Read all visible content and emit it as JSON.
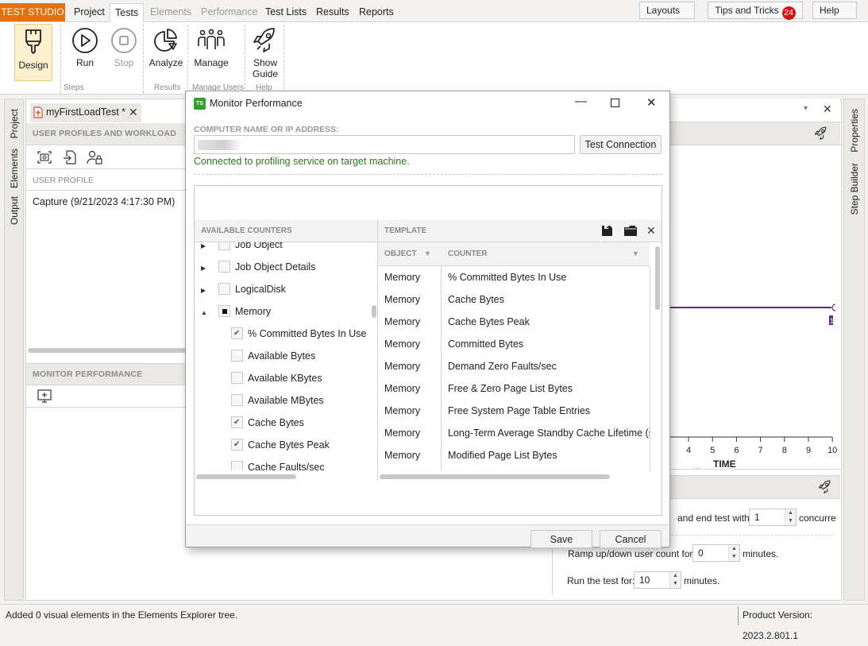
{
  "menubar": {
    "brand": "TEST STUDIO",
    "tabs": [
      {
        "label": "Project",
        "state": "normal"
      },
      {
        "label": "Tests",
        "state": "active"
      },
      {
        "label": "Elements",
        "state": "disabled"
      },
      {
        "label": "Performance",
        "state": "disabled"
      },
      {
        "label": "Test Lists",
        "state": "normal"
      },
      {
        "label": "Results",
        "state": "normal"
      },
      {
        "label": "Reports",
        "state": "normal"
      }
    ],
    "layouts_label": "Layouts",
    "tips_label": "Tips and Tricks",
    "tips_count": "24",
    "help_label": "Help"
  },
  "ribbon": {
    "buttons": {
      "design": "Design",
      "run": "Run",
      "stop": "Stop",
      "analyze": "Analyze",
      "manage": "Manage",
      "show_guide_1": "Show",
      "show_guide_2": "Guide"
    },
    "groups": {
      "steps": "Steps",
      "results": "Results",
      "manage_users": "Manage Users",
      "help": "Help"
    }
  },
  "left_strip": {
    "tabs": [
      "Project",
      "Elements",
      "Output"
    ]
  },
  "right_strip": {
    "tabs": [
      "Properties",
      "Step Builder"
    ]
  },
  "document": {
    "tab_label": "myFirstLoadTest *",
    "user_profiles_header": "USER PROFILES AND WORKLOAD",
    "user_profile_col": "USER PROFILE",
    "profiles": [
      "Capture (9/21/2023 4:17:30 PM)"
    ],
    "monitor_header": "MONITOR PERFORMANCE"
  },
  "chart_panel": {
    "x_ticks": [
      "4",
      "5",
      "6",
      "7",
      "8",
      "9",
      "10"
    ],
    "x_label": "TIME",
    "end_marker_label": "1",
    "line_color": "#5b2d8e"
  },
  "workload": {
    "end_test_label": "and end test with",
    "end_users_value": "1",
    "concurrent_label": "concurre",
    "ramp_label": "Ramp up/down user count for:",
    "ramp_value": "0",
    "ramp_unit": "minutes.",
    "run_label": "Run the test for:",
    "run_value": "10",
    "run_unit": "minutes."
  },
  "dialog": {
    "title": "Monitor Performance",
    "app_icon": "TS",
    "computer_label": "COMPUTER NAME OR IP ADDRESS:",
    "computer_value": "",
    "test_connection": "Test Connection",
    "status": "Connected to profiling service on target machine.",
    "available_header": "AVAILABLE COUNTERS",
    "tree": [
      {
        "label": "Job Object",
        "level": 0,
        "expander": "collapsed",
        "check": "none"
      },
      {
        "label": "Job Object Details",
        "level": 0,
        "expander": "collapsed",
        "check": "none"
      },
      {
        "label": "LogicalDisk",
        "level": 0,
        "expander": "collapsed",
        "check": "none"
      },
      {
        "label": "Memory",
        "level": 0,
        "expander": "expanded",
        "check": "partial"
      },
      {
        "label": "% Committed Bytes In Use",
        "level": 1,
        "check": "checked"
      },
      {
        "label": "Available Bytes",
        "level": 1,
        "check": "none"
      },
      {
        "label": "Available KBytes",
        "level": 1,
        "check": "none"
      },
      {
        "label": "Available MBytes",
        "level": 1,
        "check": "none"
      },
      {
        "label": "Cache Bytes",
        "level": 1,
        "check": "checked"
      },
      {
        "label": "Cache Bytes Peak",
        "level": 1,
        "check": "checked"
      },
      {
        "label": "Cache Faults/sec",
        "level": 1,
        "check": "none"
      }
    ],
    "template_header": "TEMPLATE",
    "columns": {
      "object": "OBJECT",
      "counter": "COUNTER"
    },
    "rows": [
      {
        "object": "Memory",
        "counter": "% Committed Bytes In Use"
      },
      {
        "object": "Memory",
        "counter": "Cache Bytes"
      },
      {
        "object": "Memory",
        "counter": "Cache Bytes Peak"
      },
      {
        "object": "Memory",
        "counter": "Committed Bytes"
      },
      {
        "object": "Memory",
        "counter": "Demand Zero Faults/sec"
      },
      {
        "object": "Memory",
        "counter": "Free & Zero Page List Bytes"
      },
      {
        "object": "Memory",
        "counter": "Free System Page Table Entries"
      },
      {
        "object": "Memory",
        "counter": "Long-Term Average Standby Cache Lifetime (s)"
      },
      {
        "object": "Memory",
        "counter": "Modified Page List Bytes"
      }
    ],
    "save": "Save",
    "cancel": "Cancel"
  },
  "statusbar": {
    "message": "Added 0 visual elements in the Elements Explorer tree.",
    "version": "Product Version: 2023.2.801.1"
  }
}
